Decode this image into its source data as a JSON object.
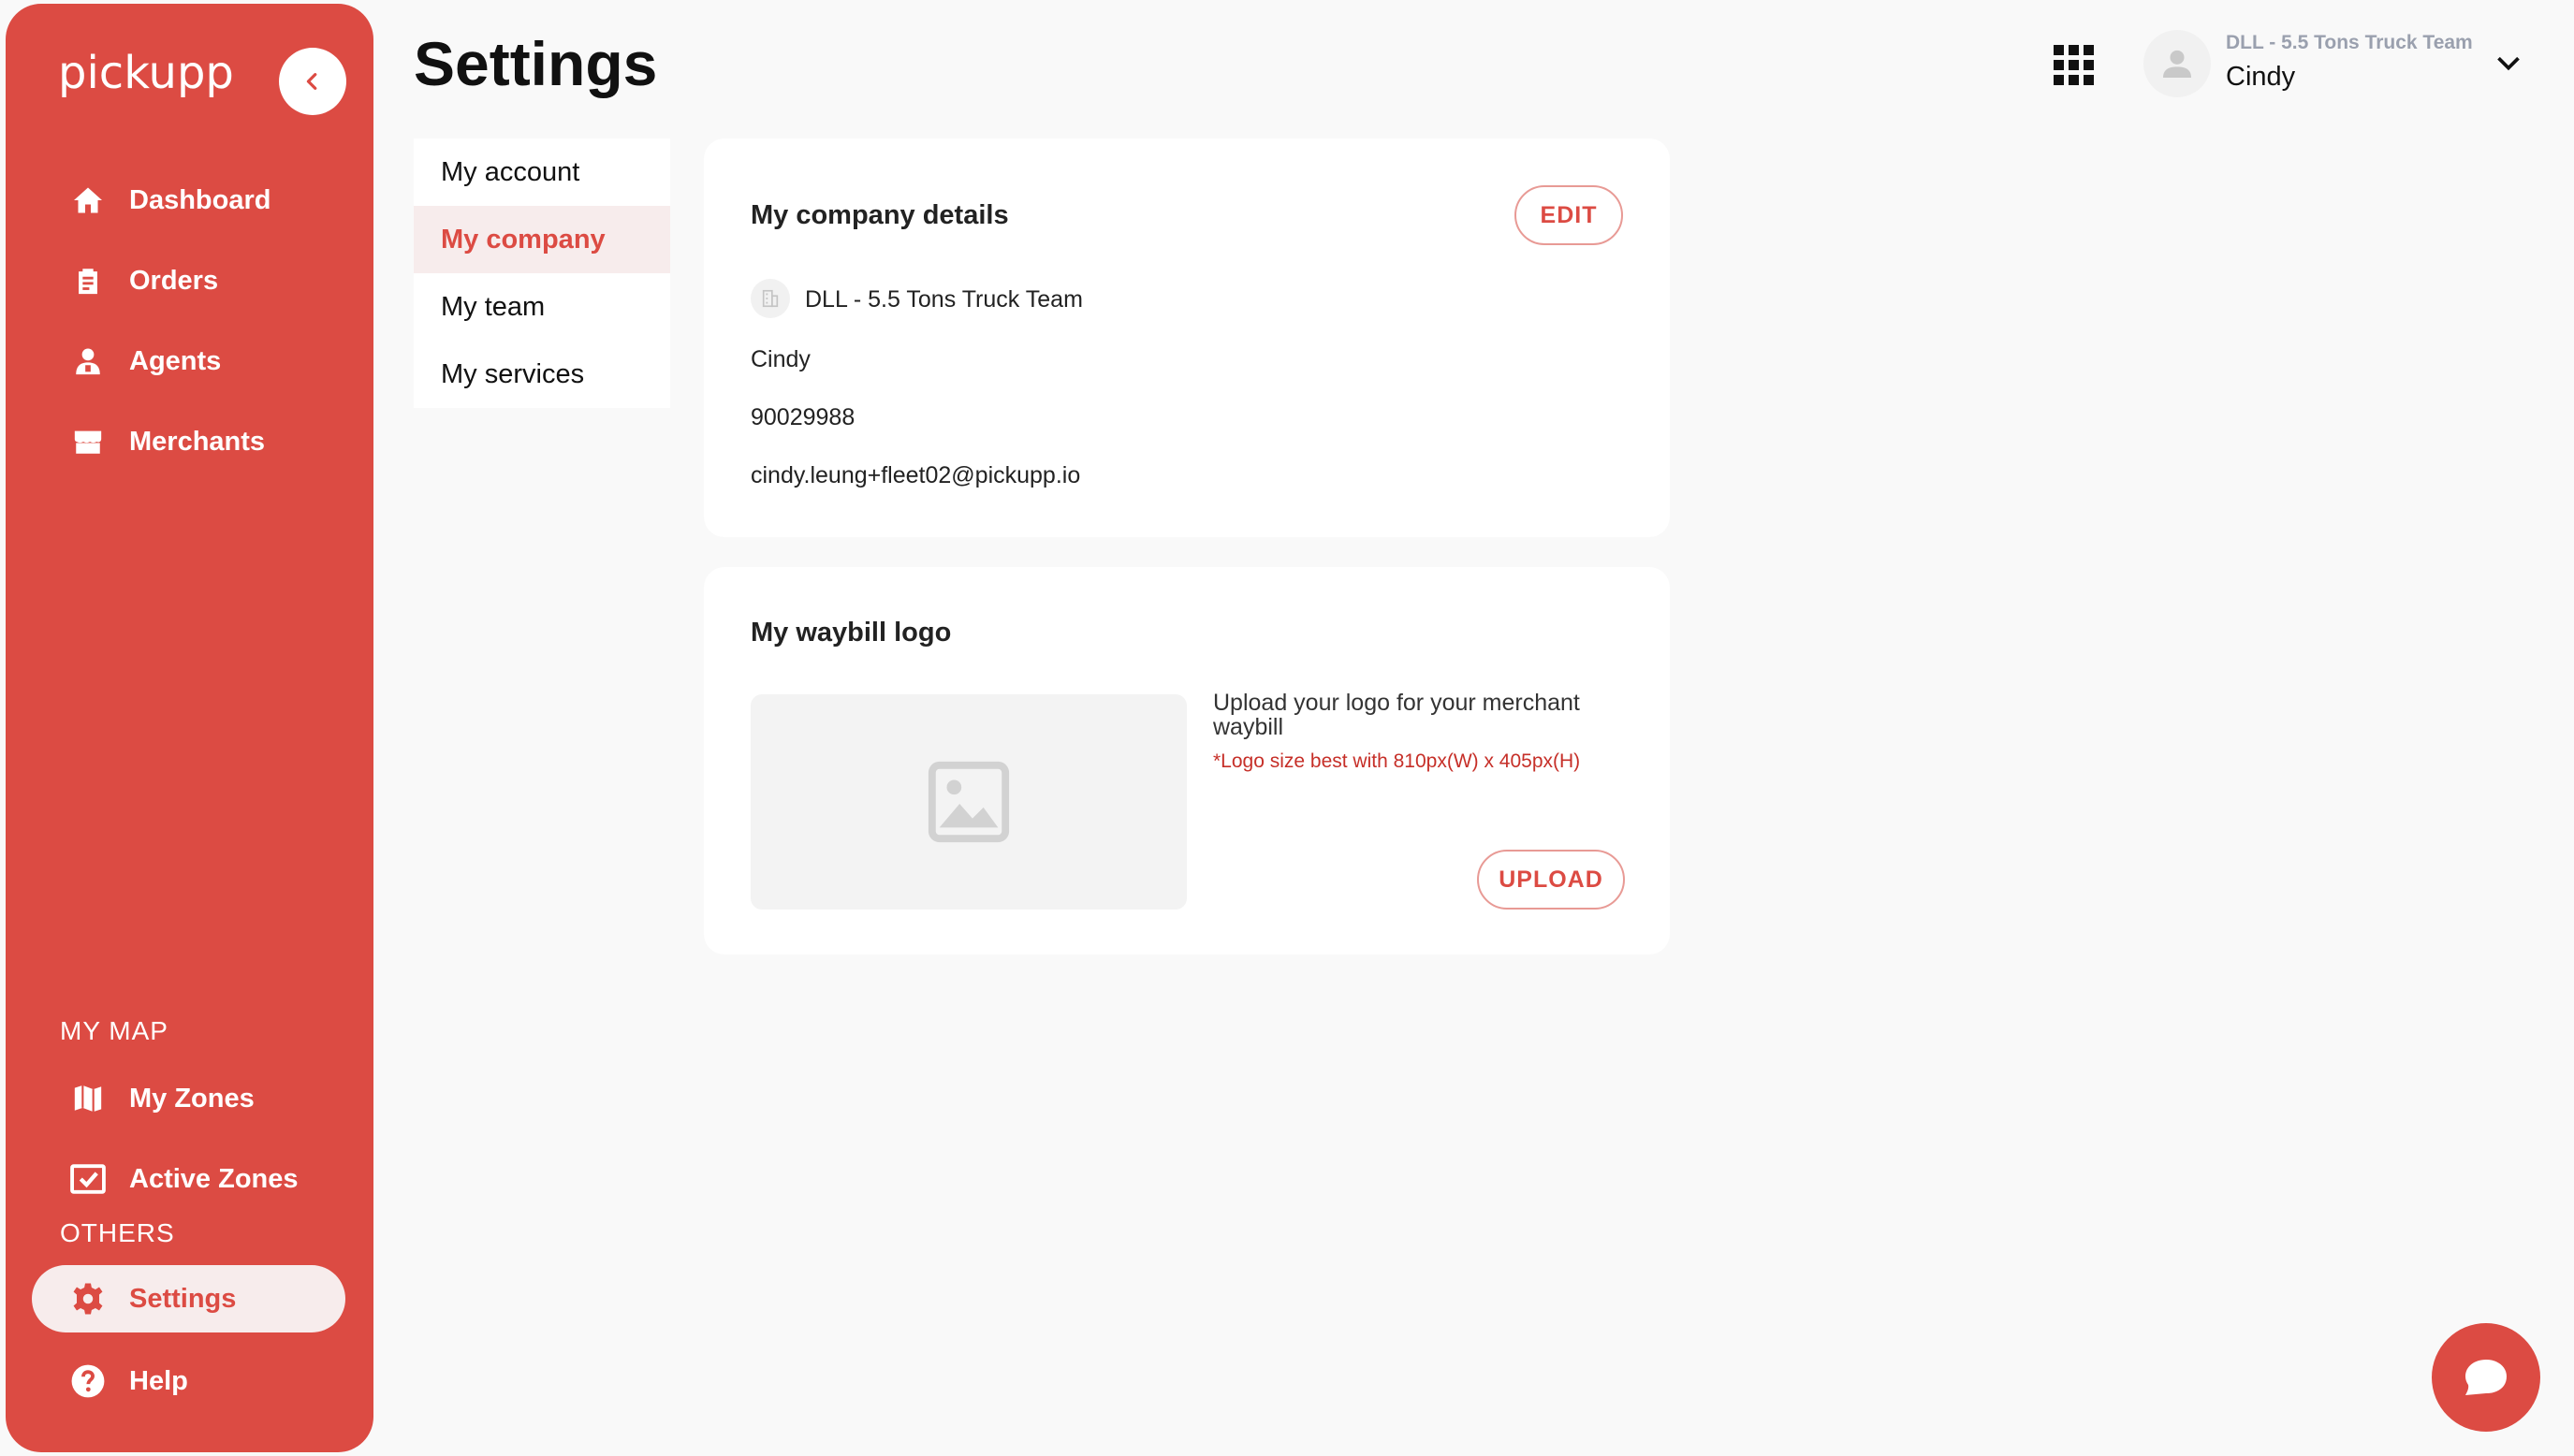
{
  "sidebar": {
    "brand": "pickupp",
    "nav": [
      {
        "label": "Dashboard",
        "icon": "home-icon"
      },
      {
        "label": "Orders",
        "icon": "clipboard-icon"
      },
      {
        "label": "Agents",
        "icon": "agent-icon"
      },
      {
        "label": "Merchants",
        "icon": "store-icon"
      }
    ],
    "section_map": "MY MAP",
    "map_nav": [
      {
        "label": "My Zones",
        "icon": "map-icon"
      },
      {
        "label": "Active Zones",
        "icon": "check-box-icon"
      }
    ],
    "section_others": "OTHERS",
    "others_nav": [
      {
        "label": "Settings",
        "icon": "gear-icon",
        "active": true
      },
      {
        "label": "Help",
        "icon": "help-icon"
      }
    ],
    "brand_color": "#dc4b43"
  },
  "header": {
    "title": "Settings",
    "user": {
      "team": "DLL - 5.5 Tons Truck Team",
      "name": "Cindy"
    }
  },
  "subnav": {
    "items": [
      {
        "label": "My account"
      },
      {
        "label": "My company",
        "active": true
      },
      {
        "label": "My team"
      },
      {
        "label": "My services"
      }
    ]
  },
  "company_card": {
    "title": "My company details",
    "edit_label": "EDIT",
    "company_name": "DLL - 5.5 Tons Truck Team",
    "contact_name": "Cindy",
    "phone": "90029988",
    "email": "cindy.leung+fleet02@pickupp.io"
  },
  "logo_card": {
    "title": "My waybill logo",
    "description": "Upload your logo for your merchant waybill",
    "hint": "*Logo size best with 810px(W) x 405px(H)",
    "upload_label": "UPLOAD"
  }
}
